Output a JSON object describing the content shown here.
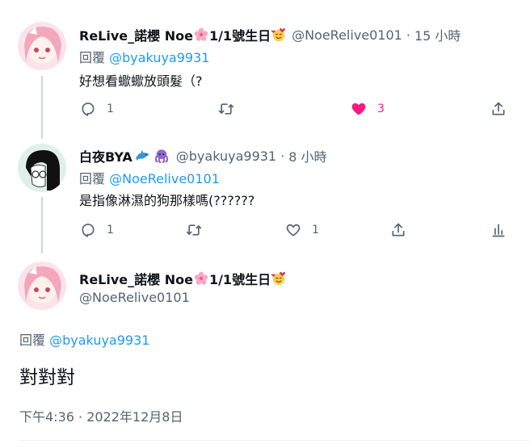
{
  "tweets": [
    {
      "name": "ReLive_諾櫻 Noe",
      "name_suffix": "1/1號生日",
      "handle": "@NoeRelive0101",
      "separator": "·",
      "time": "15 小時",
      "replying_label": "回覆",
      "replying_to": "@byakuya9931",
      "text": "好想看蠍蠍放頭髮（?",
      "reply_count": "1",
      "like_count": "3"
    },
    {
      "name": "白夜BYA",
      "handle": "@byakuya9931",
      "separator": "·",
      "time": "8 小時",
      "replying_label": "回覆",
      "replying_to": "@NoeRelive0101",
      "text": "是指像淋濕的狗那樣嗎(??????",
      "reply_count": "1",
      "like_count": "1"
    }
  ],
  "main_tweet": {
    "name": "ReLive_諾櫻 Noe",
    "name_suffix": "1/1號生日",
    "handle": "@NoeRelive0101",
    "replying_label": "回覆",
    "replying_to": "@byakuya9931",
    "text": "對對對",
    "timestamp": "下午4:36 · 2022年12月8日"
  },
  "colors": {
    "text": "#0f1419",
    "secondary": "#536471",
    "link": "#1d9bf0",
    "like": "#f91880",
    "divider": "#eff3f4"
  },
  "icons": [
    "reply-icon",
    "retweet-icon",
    "like-icon",
    "share-icon",
    "analytics-icon",
    "more-icon"
  ]
}
